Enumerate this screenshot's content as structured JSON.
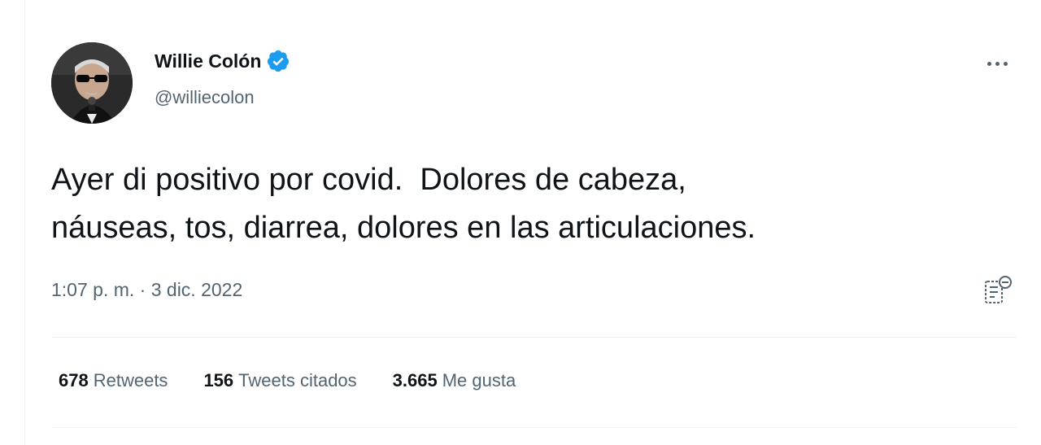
{
  "author": {
    "display_name": "Willie Colón",
    "handle": "@williecolon",
    "verified_icon": "verified-badge-icon"
  },
  "tweet": {
    "text": "Ayer di positivo por covid.  Dolores de cabeza,\nnáuseas, tos, diarrea, dolores en las articulaciones.",
    "timestamp": "1:07 p. m. · 3 dic. 2022"
  },
  "stats": {
    "retweets_count": "678",
    "retweets_label": "Retweets",
    "quotes_count": "156",
    "quotes_label": "Tweets citados",
    "likes_count": "3.665",
    "likes_label": "Me gusta"
  },
  "icons": {
    "more": "more-options-icon",
    "analytics": "analytics-icon"
  },
  "colors": {
    "text_primary": "#0f1419",
    "text_secondary": "#536471",
    "verified_blue": "#1d9bf0",
    "divider": "#eff3f4"
  }
}
